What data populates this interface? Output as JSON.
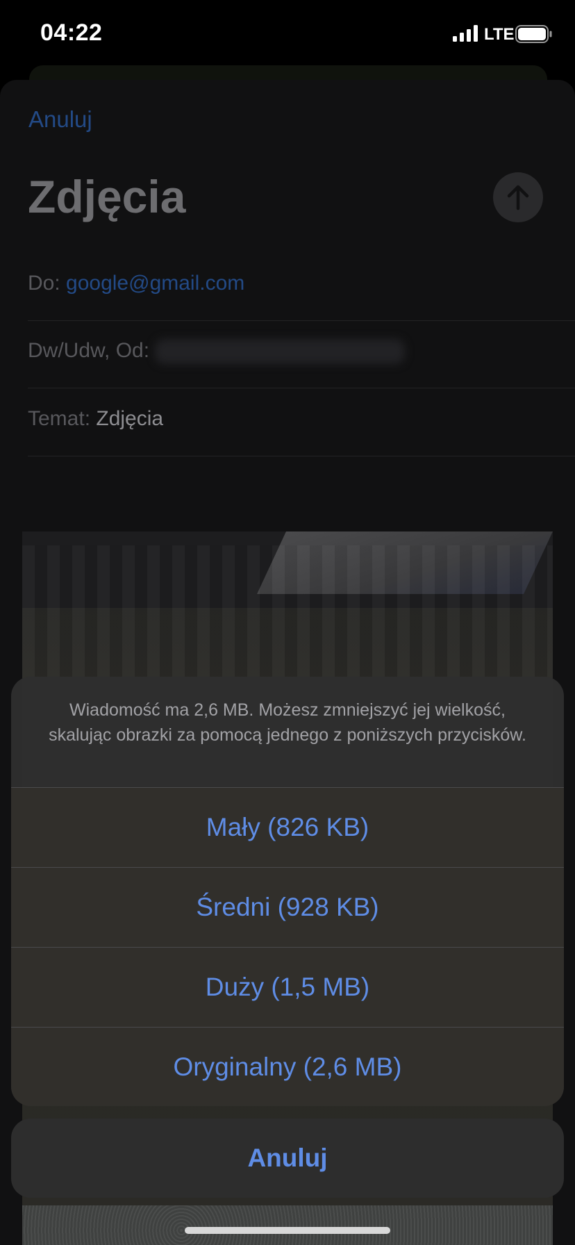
{
  "status_bar": {
    "time": "04:22",
    "network": "LTE",
    "icons": [
      "signal-icon",
      "battery-icon"
    ]
  },
  "compose": {
    "cancel_label": "Anuluj",
    "title": "Zdjęcia",
    "send_icon": "arrow-up-icon",
    "to_label": "Do:",
    "to_value": "google@gmail.com",
    "cc_label": "Dw/Udw, Od:",
    "subject_label": "Temat:",
    "subject_value": "Zdjęcia"
  },
  "action_sheet": {
    "message": "Wiadomość ma 2,6 MB. Możesz zmniejszyć jej wielkość, skalując obrazki za pomocą jednego z poniższych przycisków.",
    "options": [
      {
        "label": "Mały (826 KB)"
      },
      {
        "label": "Średni (928 KB)"
      },
      {
        "label": "Duży (1,5 MB)"
      },
      {
        "label": "Oryginalny (2,6 MB)"
      }
    ],
    "cancel_label": "Anuluj"
  },
  "colors": {
    "accent": "#5f8de6",
    "dimmed_link": "#234a86",
    "sheet_background": "#2e2e2e"
  }
}
